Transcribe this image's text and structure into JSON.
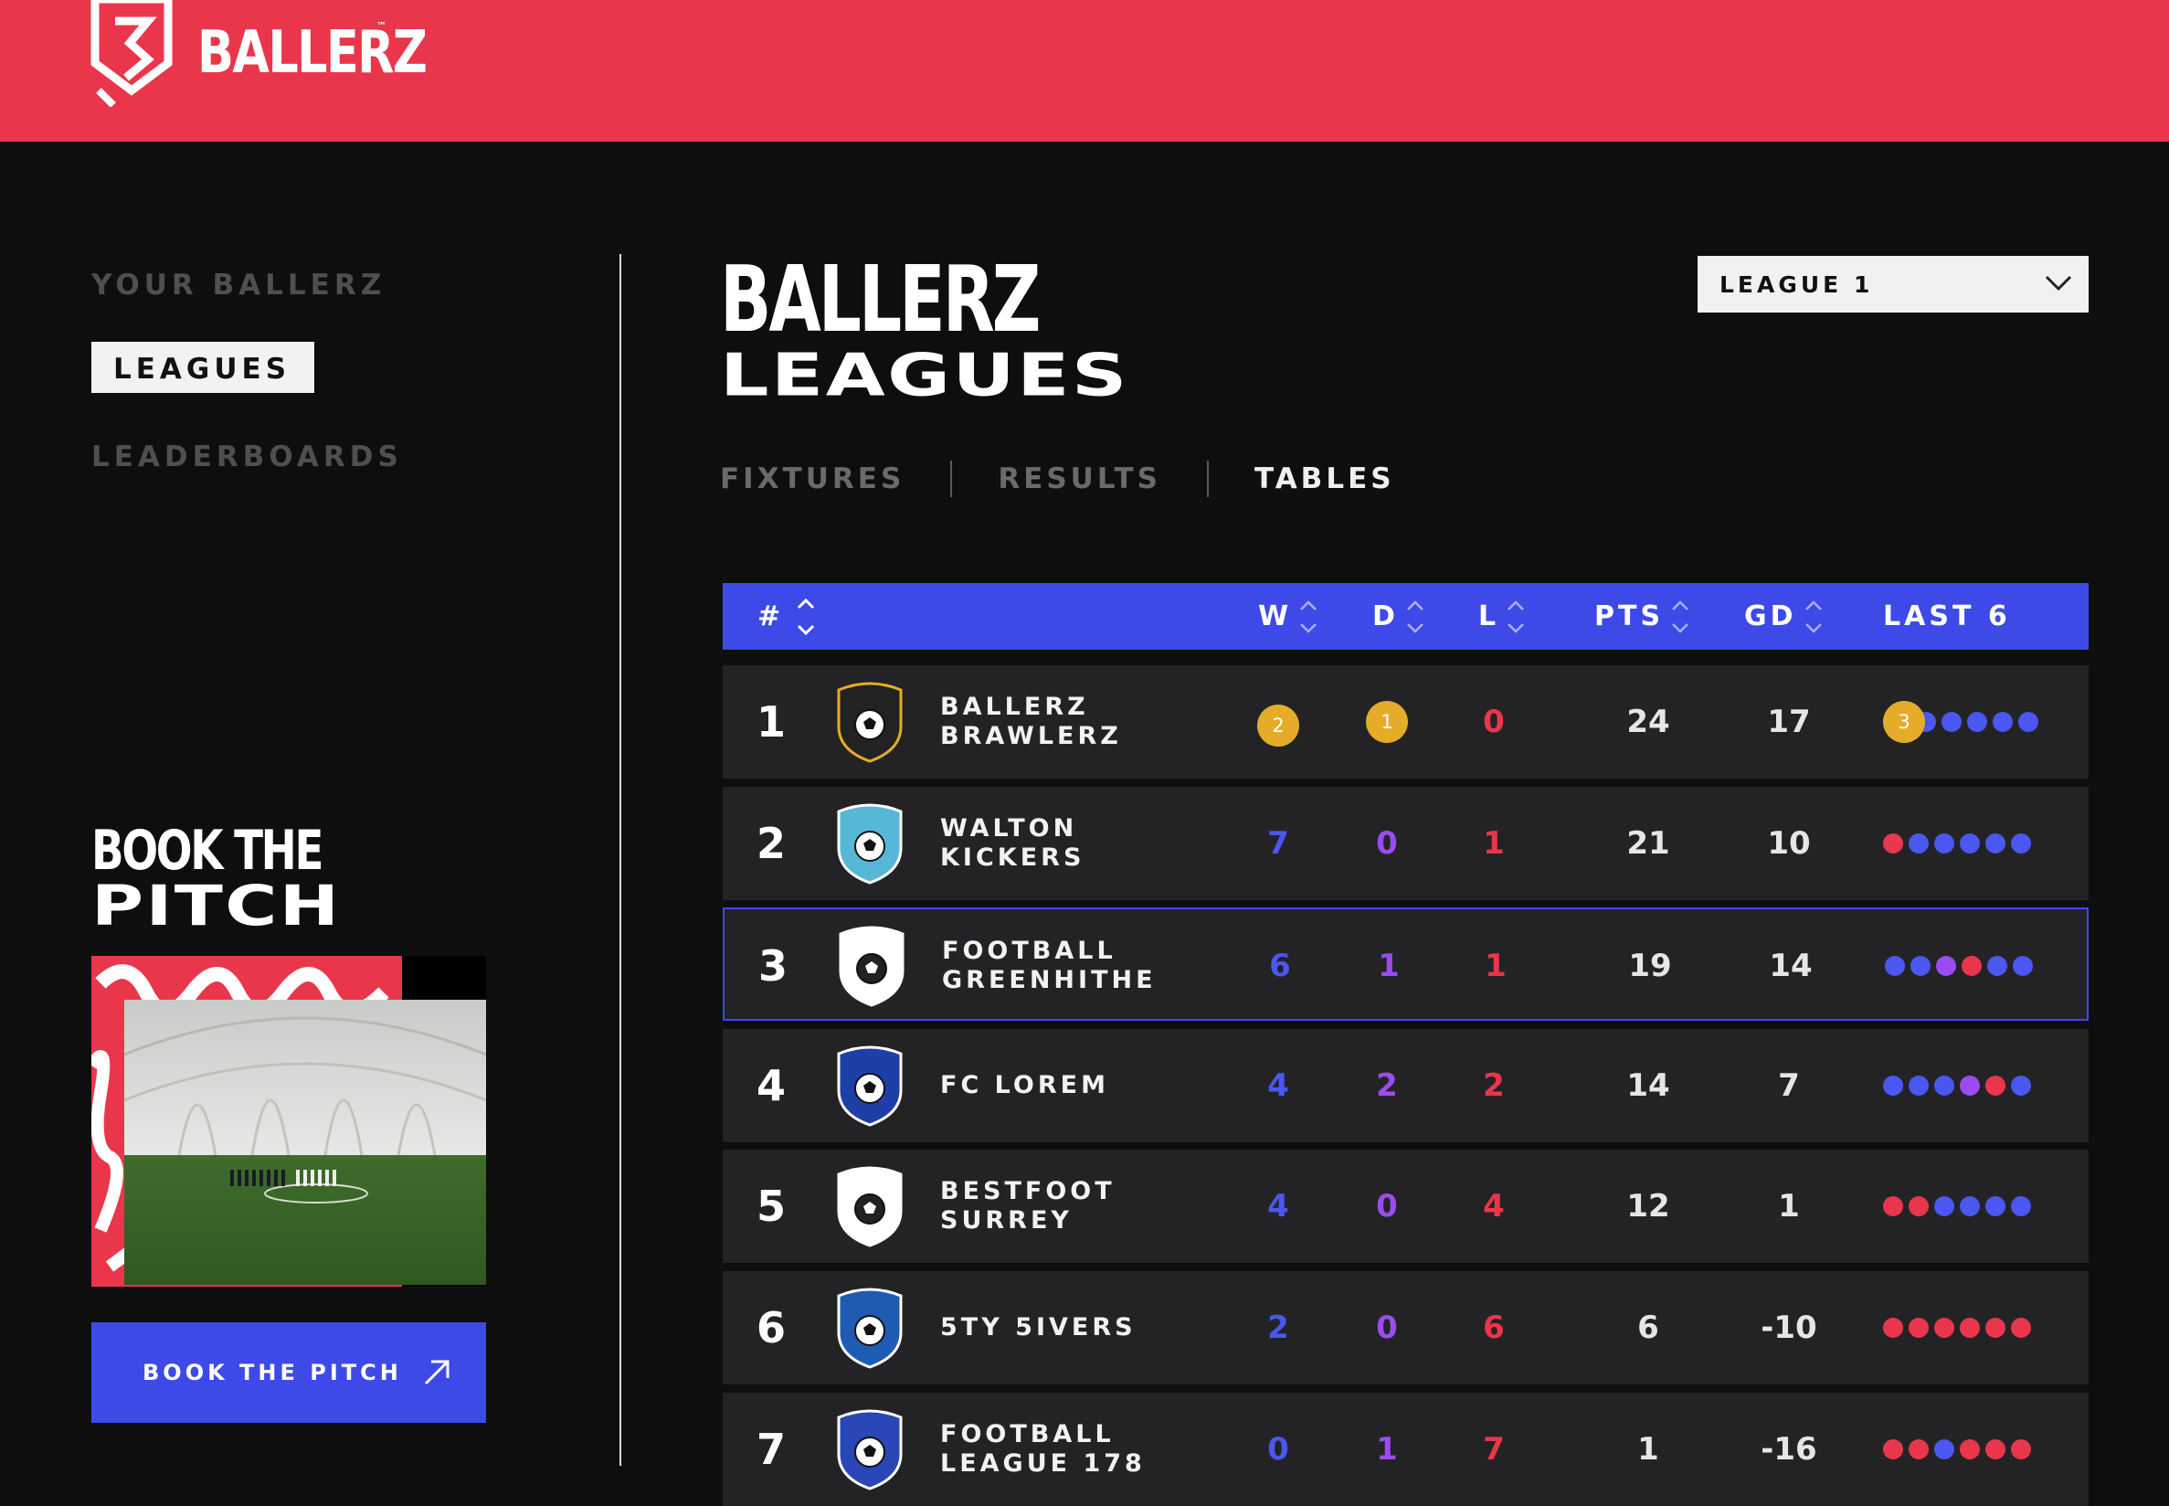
{
  "brand": {
    "name": "BALLERZ",
    "tm": "™"
  },
  "sidebar": {
    "items": [
      {
        "label": "YOUR BALLERZ",
        "active": false
      },
      {
        "label": "LEAGUES",
        "active": true
      },
      {
        "label": "LEADERBOARDS",
        "active": false
      }
    ],
    "promo": {
      "title_line1": "BOOK THE",
      "title_line2": "PITCH",
      "button_label": "BOOK THE PITCH"
    }
  },
  "main": {
    "title_line1": "BALLERZ",
    "title_line2": "LEAGUES",
    "league_select": {
      "value": "LEAGUE 1"
    },
    "tabs": [
      {
        "label": "FIXTURES",
        "active": false
      },
      {
        "label": "RESULTS",
        "active": false
      },
      {
        "label": "TABLES",
        "active": true
      }
    ]
  },
  "table": {
    "headers": {
      "rank": "#",
      "w": "W",
      "d": "D",
      "l": "L",
      "pts": "PTS",
      "gd": "GD",
      "last6": "LAST 6"
    },
    "rows": [
      {
        "rank": "1",
        "team_line1": "BALLERZ",
        "team_line2": "BRAWLERZ",
        "crest": "lorem-crest-icon",
        "w": "2",
        "d": "1",
        "l": "0",
        "pts": "24",
        "gd": "17",
        "form_badge": "3",
        "form": [
          "blue",
          "blue",
          "blue",
          "blue",
          "blue"
        ]
      },
      {
        "rank": "2",
        "team_line1": "WALTON",
        "team_line2": "KICKERS",
        "crest": "kickers-crest-icon",
        "w": "7",
        "d": "0",
        "l": "1",
        "pts": "21",
        "gd": "10",
        "form": [
          "red",
          "blue",
          "blue",
          "blue",
          "blue",
          "blue"
        ]
      },
      {
        "rank": "3",
        "team_line1": "FOOTBALL",
        "team_line2": "GREENHITHE",
        "crest": "football-crest-icon",
        "w": "6",
        "d": "1",
        "l": "1",
        "pts": "19",
        "gd": "14",
        "form": [
          "blue",
          "blue",
          "purple",
          "red",
          "blue",
          "blue"
        ]
      },
      {
        "rank": "4",
        "team_line1": "FC LOREM",
        "team_line2": "",
        "crest": "fc-lorem-crest-icon",
        "w": "4",
        "d": "2",
        "l": "2",
        "pts": "14",
        "gd": "7",
        "form": [
          "blue",
          "blue",
          "blue",
          "purple",
          "red",
          "blue"
        ]
      },
      {
        "rank": "5",
        "team_line1": "BESTFOOT",
        "team_line2": "SURREY",
        "crest": "bestfoot-crest-icon",
        "w": "4",
        "d": "0",
        "l": "4",
        "pts": "12",
        "gd": "1",
        "form": [
          "red",
          "red",
          "blue",
          "blue",
          "blue",
          "blue"
        ]
      },
      {
        "rank": "6",
        "team_line1": "5TY 5IVERS",
        "team_line2": "",
        "crest": "55-crest-icon",
        "w": "2",
        "d": "0",
        "l": "6",
        "pts": "6",
        "gd": "-10",
        "form": [
          "red",
          "red",
          "red",
          "red",
          "red",
          "red"
        ]
      },
      {
        "rank": "7",
        "team_line1": "FOOTBALL",
        "team_line2": "LEAGUE 178",
        "crest": "football-league-crest-icon",
        "w": "0",
        "d": "1",
        "l": "7",
        "pts": "1",
        "gd": "-16",
        "form": [
          "red",
          "red",
          "blue",
          "red",
          "red",
          "red"
        ]
      }
    ]
  },
  "colors": {
    "brand_red": "#ea364b",
    "accent_blue": "#3d4ae8",
    "win_blue": "#4a57f0",
    "draw_purple": "#9b4cf0",
    "gold": "#e5ac2a",
    "bg": "#0e0e0f",
    "row_bg": "#232325"
  }
}
